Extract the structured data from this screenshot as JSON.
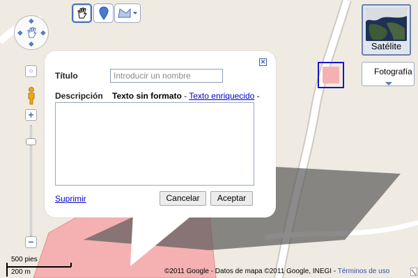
{
  "map": {
    "colors": {
      "ground": "#efebe2",
      "polygon": "#f5b1b1",
      "road": "#ffffff",
      "shadow": "#5a5a5a"
    }
  },
  "toolbar": {
    "hand_icon": "hand-icon",
    "marker_icon": "placemark-icon",
    "line_icon": "line-icon"
  },
  "map_type": {
    "satellite_label": "Satélite",
    "photos_label": "Fotografía"
  },
  "dialog": {
    "title_label": "Título",
    "title_placeholder": "Introducir un nombre",
    "description_label": "Descripción",
    "format_plain": "Texto sin formato",
    "format_sep": " - ",
    "format_rich": "Texto enriquecido",
    "format_trailing": " -",
    "delete_label": "Suprimir",
    "cancel_label": "Cancelar",
    "accept_label": "Aceptar",
    "close_symbol": "✕"
  },
  "scale": {
    "top_label": "500 pies",
    "bottom_label": "200 m"
  },
  "footer": {
    "copyright": "©2011 Google - Datos de mapa ©2011 Google, INEGI - ",
    "terms_label": "Términos de uso"
  }
}
